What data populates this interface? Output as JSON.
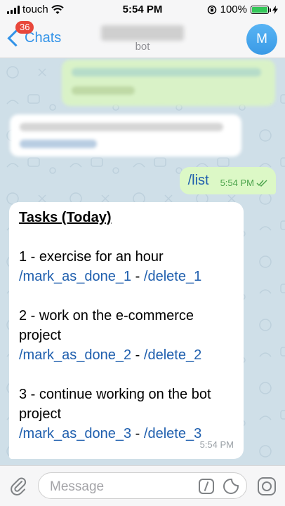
{
  "status_bar": {
    "carrier": "touch",
    "time": "5:54 PM",
    "battery": "100%"
  },
  "nav": {
    "back_label": "Chats",
    "unread_count": "36",
    "subtitle": "bot",
    "avatar_initial": "M"
  },
  "messages": {
    "outgoing": {
      "text": "/list",
      "time": "5:54 PM"
    },
    "incoming": {
      "heading": "Tasks (Today)",
      "tasks": [
        {
          "text": "1 - exercise for an hour",
          "done_cmd": "/mark_as_done_1",
          "delete_cmd": "/delete_1"
        },
        {
          "text_line1": "2 - work on the e-commerce",
          "text_line2": "project",
          "done_cmd": "/mark_as_done_2",
          "delete_cmd": "/delete_2"
        },
        {
          "text_line1": "3 - continue working on the bot",
          "text_line2": "project",
          "done_cmd": "/mark_as_done_3",
          "delete_cmd": "/delete_3"
        }
      ],
      "separator": " - ",
      "time": "5:54 PM"
    }
  },
  "input": {
    "placeholder": "Message"
  },
  "colors": {
    "accent": "#3393e8",
    "link": "#1f5fae",
    "badge": "#e8473b",
    "outgoing_bubble": "#dcf8c6",
    "chat_bg": "#cfdfe8"
  }
}
